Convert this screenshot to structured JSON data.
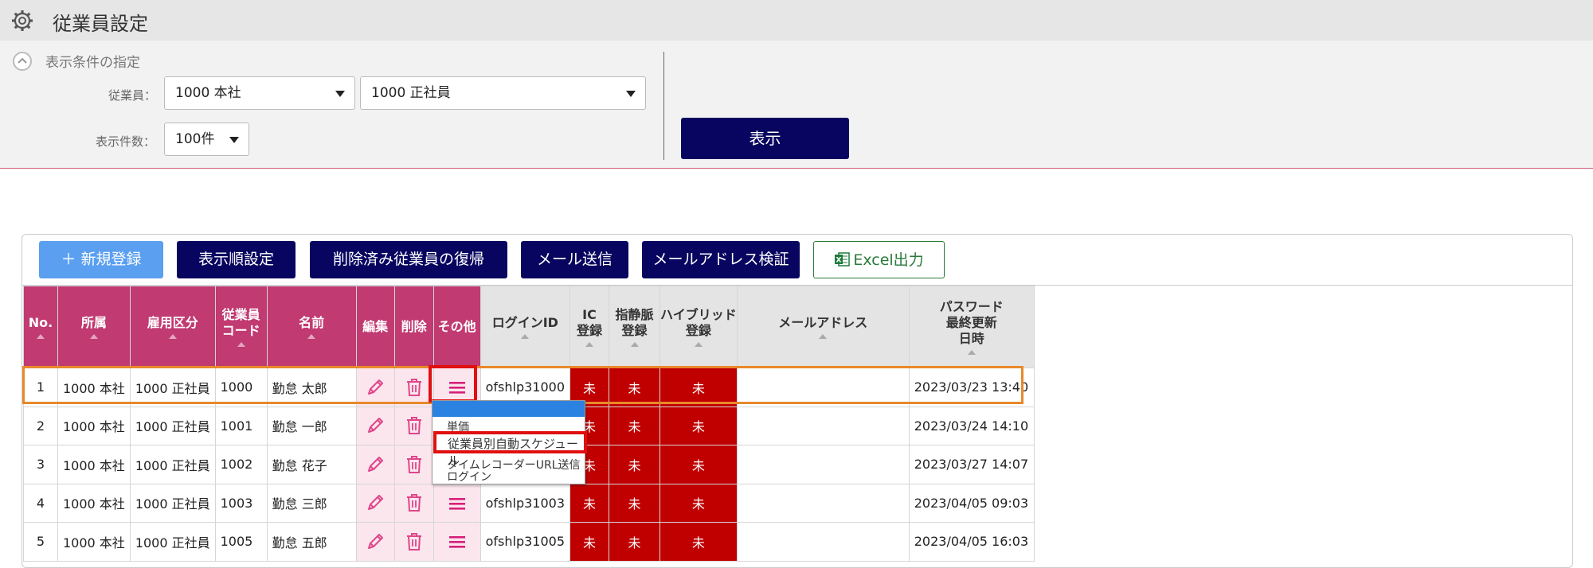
{
  "header": {
    "title": "従業員設定",
    "icon": "gear-icon"
  },
  "filter": {
    "section_label": "表示条件の指定",
    "employee_label": "従業員：",
    "company_select": "1000 本社",
    "employment_select": "1000 正社員",
    "count_label": "表示件数：",
    "count_select": "100件",
    "show_button": "表示"
  },
  "toolbar": {
    "new_button": "＋ 新規登録",
    "order_button": "表示順設定",
    "restore_button": "削除済み従業員の復帰",
    "mail_button": "メール送信",
    "verify_button": "メールアドレス検証",
    "excel_button": "Excel出力"
  },
  "table": {
    "headers": {
      "no": "No.",
      "dept": "所属",
      "type": "雇用区分",
      "code1": "従業員",
      "code2": "コード",
      "name": "名前",
      "edit": "編集",
      "delete": "削除",
      "other": "その他",
      "login": "ログインID",
      "ic1": "IC",
      "ic2": "登録",
      "vein1": "指静脈",
      "vein2": "登録",
      "hybrid1": "ハイブリッド",
      "hybrid2": "登録",
      "mail": "メールアドレス",
      "pw1": "パスワード",
      "pw2": "最終更新",
      "pw3": "日時"
    },
    "rows": [
      {
        "no": "1",
        "dept": "1000 本社",
        "type": "1000 正社員",
        "code": "1000",
        "name": "勤怠 太郎",
        "login": "ofshlp31000",
        "ic": "未",
        "vein": "未",
        "hybrid": "未",
        "mail": "",
        "updated": "2023/03/23 13:40"
      },
      {
        "no": "2",
        "dept": "1000 本社",
        "type": "1000 正社員",
        "code": "1001",
        "name": "勤怠 一郎",
        "login": "",
        "ic": "未",
        "vein": "未",
        "hybrid": "未",
        "mail": "",
        "updated": "2023/03/24 14:10"
      },
      {
        "no": "3",
        "dept": "1000 本社",
        "type": "1000 正社員",
        "code": "1002",
        "name": "勤怠 花子",
        "login": "",
        "ic": "未",
        "vein": "未",
        "hybrid": "未",
        "mail": "",
        "updated": "2023/03/27 14:07"
      },
      {
        "no": "4",
        "dept": "1000 本社",
        "type": "1000 正社員",
        "code": "1003",
        "name": "勤怠 三郎",
        "login": "ofshlp31003",
        "ic": "未",
        "vein": "未",
        "hybrid": "未",
        "mail": "",
        "updated": "2023/04/05 09:03"
      },
      {
        "no": "5",
        "dept": "1000 本社",
        "type": "1000 正社員",
        "code": "1005",
        "name": "勤怠 五郎",
        "login": "ofshlp31005",
        "ic": "未",
        "vein": "未",
        "hybrid": "未",
        "mail": "",
        "updated": "2023/04/05 16:03"
      }
    ]
  },
  "dropdown_menu": {
    "item1": "単価",
    "item2": "従業員別自動スケジュール",
    "item3": "タイムレコーダーURL送信",
    "item4": "ログイン"
  },
  "colors": {
    "header_pink": "#c13a72",
    "navy_button": "#07055f",
    "status_red": "#c00000",
    "highlight_orange": "#e8892a",
    "highlight_red": "#e01010"
  }
}
